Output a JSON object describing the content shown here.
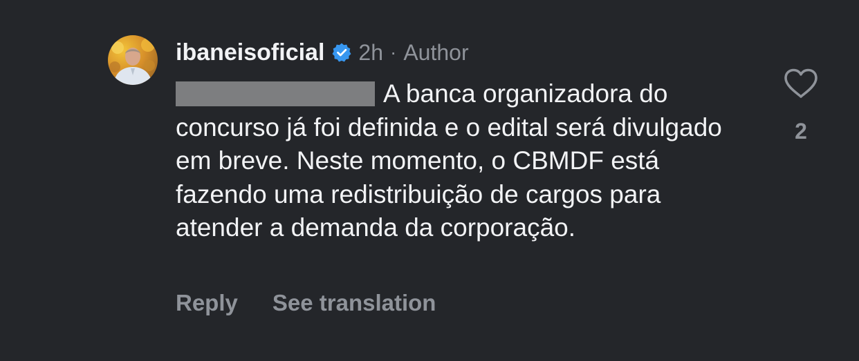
{
  "comment": {
    "author": {
      "username": "ibaneisoficial",
      "verified_icon": "verified-badge-icon",
      "avatar_icon": "profile-photo"
    },
    "timestamp": "2h",
    "separator": "·",
    "role": "Author",
    "text": "A banca organizadora do concurso já foi definida e o edital será divulgado em breve. Neste momento, o CBMDF está fazendo uma redistribuição de cargos para atender a demanda da corporação.",
    "actions": {
      "reply": "Reply",
      "see_translation": "See translation"
    },
    "likes": {
      "icon": "heart-icon",
      "count": "2"
    }
  },
  "colors": {
    "background": "#24262a",
    "primary_text": "#f2f3f5",
    "secondary_text": "#8f939a",
    "verified_blue": "#3797f0",
    "redaction": "#7d7e80"
  }
}
